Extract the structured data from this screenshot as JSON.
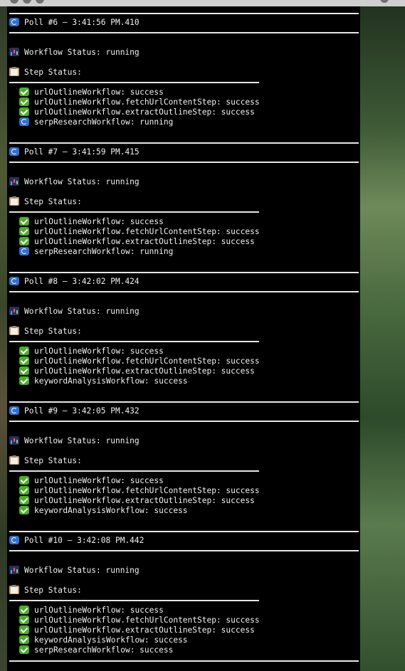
{
  "polls": [
    {
      "header": "Poll #6 – 3:41:56 PM.410",
      "workflow_status": "Workflow Status: running",
      "step_status": "Step Status:",
      "steps": [
        {
          "text": "urlOutlineWorkflow: success",
          "icon": "check-icon"
        },
        {
          "text": "urlOutlineWorkflow.fetchUrlContentStep: success",
          "icon": "check-icon"
        },
        {
          "text": "urlOutlineWorkflow.extractOutlineStep: success",
          "icon": "check-icon"
        },
        {
          "text": "serpResearchWorkflow: running",
          "icon": "refresh-icon"
        }
      ]
    },
    {
      "header": "Poll #7 – 3:41:59 PM.415",
      "workflow_status": "Workflow Status: running",
      "step_status": "Step Status:",
      "steps": [
        {
          "text": "urlOutlineWorkflow: success",
          "icon": "check-icon"
        },
        {
          "text": "urlOutlineWorkflow.fetchUrlContentStep: success",
          "icon": "check-icon"
        },
        {
          "text": "urlOutlineWorkflow.extractOutlineStep: success",
          "icon": "check-icon"
        },
        {
          "text": "serpResearchWorkflow: running",
          "icon": "refresh-icon"
        }
      ]
    },
    {
      "header": "Poll #8 – 3:42:02 PM.424",
      "workflow_status": "Workflow Status: running",
      "step_status": "Step Status:",
      "steps": [
        {
          "text": "urlOutlineWorkflow: success",
          "icon": "check-icon"
        },
        {
          "text": "urlOutlineWorkflow.fetchUrlContentStep: success",
          "icon": "check-icon"
        },
        {
          "text": "urlOutlineWorkflow.extractOutlineStep: success",
          "icon": "check-icon"
        },
        {
          "text": "keywordAnalysisWorkflow: success",
          "icon": "check-icon"
        }
      ]
    },
    {
      "header": "Poll #9 – 3:42:05 PM.432",
      "workflow_status": "Workflow Status: running",
      "step_status": "Step Status:",
      "steps": [
        {
          "text": "urlOutlineWorkflow: success",
          "icon": "check-icon"
        },
        {
          "text": "urlOutlineWorkflow.fetchUrlContentStep: success",
          "icon": "check-icon"
        },
        {
          "text": "urlOutlineWorkflow.extractOutlineStep: success",
          "icon": "check-icon"
        },
        {
          "text": "keywordAnalysisWorkflow: success",
          "icon": "check-icon"
        }
      ]
    },
    {
      "header": "Poll #10 – 3:42:08 PM.442",
      "workflow_status": "Workflow Status: running",
      "step_status": "Step Status:",
      "steps": [
        {
          "text": "urlOutlineWorkflow: success",
          "icon": "check-icon"
        },
        {
          "text": "urlOutlineWorkflow.fetchUrlContentStep: success",
          "icon": "check-icon"
        },
        {
          "text": "urlOutlineWorkflow.extractOutlineStep: success",
          "icon": "check-icon"
        },
        {
          "text": "keywordAnalysisWorkflow: success",
          "icon": "check-icon"
        },
        {
          "text": "serpResearchWorkflow: success",
          "icon": "check-icon"
        }
      ]
    }
  ]
}
